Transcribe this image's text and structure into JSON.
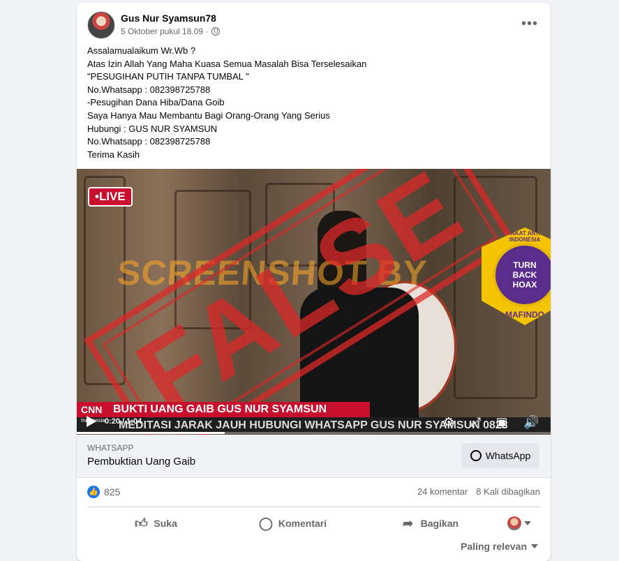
{
  "post": {
    "author": "Gus Nur Syamsun78",
    "timestamp": "5 Oktober pukul 18.09",
    "privacy_icon": "globe-icon",
    "more_label": "•••",
    "text_lines": [
      "Assalamualaikum Wr.Wb ?",
      "Atas Izin Allah Yang Maha Kuasa Semua Masalah Bisa Terselesaikan",
      "\"PESUGIHAN PUTIH TANPA TUMBAL \"",
      "No.Whatsapp : 082398725788",
      "-Pesugihan Dana Hiba/Dana Goib",
      "Saya Hanya Mau Membantu Bagi Orang-Orang Yang Serius",
      "Hubungi : GUS NUR SYAMSUN",
      "No.Whatsapp : 082398725788",
      "Terima Kasih"
    ]
  },
  "video": {
    "live_label": "•LIVE",
    "watermark": "SCREENSHOT BY",
    "stamp": "FALSE",
    "badge_ring": "MASYARAKAT ANTI FITNAH INDONESIA",
    "badge_center_1": "TURN",
    "badge_center_2": "BACK",
    "badge_center_3": "HOAX",
    "badge_org": "MAFINDO",
    "banner_top": "BUKTI UANG GAIB GUS NUR SYAMSUN",
    "banner_bottom": "MEDITASI JARAK JAUH HUBUNGI WHATSAPP GUS NUR SYAMSUN 0823",
    "channel": "CNN",
    "channel_sub": "Indonesia",
    "time_current": "0:20",
    "time_total": "1:04",
    "time_display": "0:20 / 1:04",
    "progress_fraction": 0.3125
  },
  "link": {
    "domain": "WHATSAPP",
    "title": "Pembuktian Uang Gaib",
    "button_label": "WhatsApp"
  },
  "engagement": {
    "like_count": "825",
    "comments": "24 komentar",
    "shares": "8 Kali dibagikan"
  },
  "actions": {
    "like": "Suka",
    "comment": "Komentari",
    "share": "Bagikan"
  },
  "sort_label": "Paling relevan",
  "colors": {
    "facebook_blue": "#1877f2",
    "live_red": "#c8102e",
    "stamp_red": "#dc2828",
    "badge_yellow": "#f5c400",
    "badge_purple": "#5a2d8c"
  }
}
